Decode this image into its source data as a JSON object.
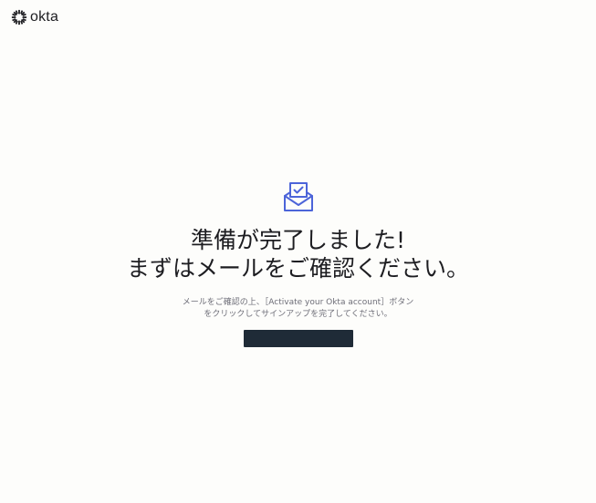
{
  "brand": {
    "name": "okta",
    "logo_icon": "okta-sunburst-icon"
  },
  "confirmation": {
    "icon": "envelope-check-icon",
    "accent_color": "#4c64d9",
    "heading_line1": "準備が完了しました!",
    "heading_line2": "まずはメールをご確認ください。",
    "body_line1": "メールをご確認の上、［Activate your Okta account］ボタン",
    "body_line2": "をクリックしてサインアップを完了してください。",
    "button_label": ""
  }
}
